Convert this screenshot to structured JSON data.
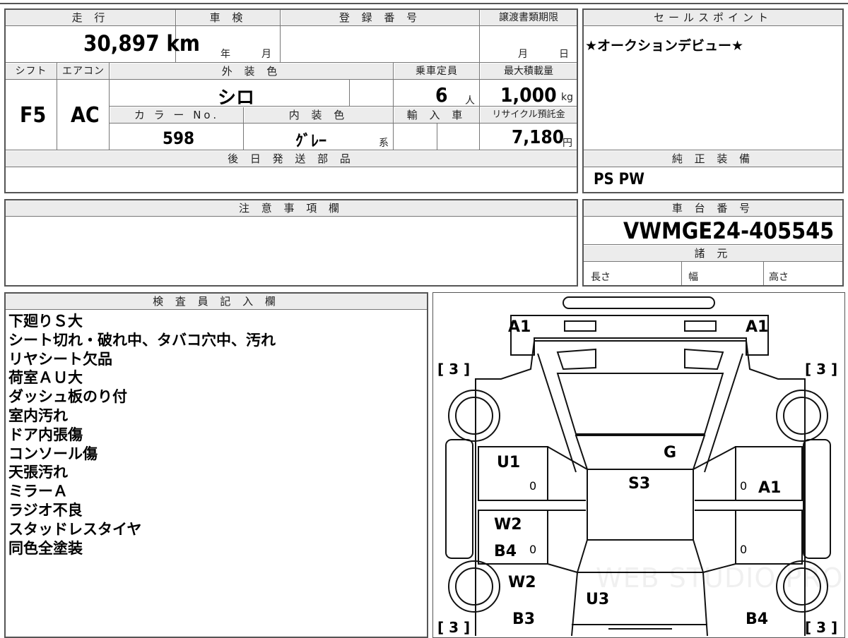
{
  "vehicle": {
    "mileage_label": "走 行",
    "mileage": "30,897 km",
    "shaken_label": "車 検",
    "shaken_year": "年",
    "shaken_month": "月",
    "reg_label": "登 録 番 号",
    "transfer_label": "譲渡書類期限",
    "transfer_month": "月",
    "transfer_day": "日",
    "shift_label": "シフト",
    "shift": "F5",
    "ac_label": "エアコン",
    "ac": "AC",
    "ext_color_label": "外 装 色",
    "ext_color": "シロ",
    "capacity_label": "乗車定員",
    "capacity": "6",
    "capacity_unit": "人",
    "load_label": "最大積載量",
    "load": "1,000",
    "load_unit": "kg",
    "color_no_label": "カ ラ ー No.",
    "color_no": "598",
    "int_color_label": "内 装 色",
    "int_color": "ｸﾞﾚｰ",
    "int_color_suffix": "系",
    "import_label": "輸 入 車",
    "recycle_label": "リサイクル預託金",
    "recycle": "7,180",
    "recycle_unit": "円",
    "later_parts_label": "後 日 発 送 部 品"
  },
  "sales_point": {
    "label": "セールスポイント",
    "text": "★オークションデビュー★"
  },
  "standard_equipment": {
    "label": "純 正 装 備",
    "text": "PS PW"
  },
  "caution": {
    "label": "注 意 事 項 欄"
  },
  "chassis": {
    "label": "車 台 番 号",
    "number": "VWMGE24-405545",
    "specs_label": "諸 元",
    "length_label": "長さ",
    "width_label": "幅",
    "height_label": "高さ"
  },
  "inspector": {
    "label": "検 査 員 記 入 欄",
    "lines": [
      "下廻りＳ大",
      "シート切れ・破れ中、タバコ穴中、汚れ",
      "リヤシート欠品",
      "荷室ＡＵ大",
      "ダッシュ板のり付",
      "室内汚れ",
      "ドア内張傷",
      "コンソール傷",
      "天張汚れ",
      "ミラーＡ",
      "ラジオ不良",
      "スタッドレスタイヤ",
      "同色全塗装"
    ]
  },
  "diagram": {
    "marks": {
      "a1_left": "A1",
      "a1_right": "A1",
      "tire_fl": "[ 3 ]",
      "tire_fr": "[ 3 ]",
      "tire_rl": "[ 3 ]",
      "tire_rr": "[ 3 ]",
      "g": "G",
      "u1": "U1",
      "s3": "S3",
      "a1_door": "A1",
      "w2_upper": "W2",
      "b4_left": "B4",
      "w2_lower": "W2",
      "u3": "U3",
      "b3": "B3",
      "b4_right": "B4",
      "zero_1": "0",
      "zero_2": "0",
      "zero_3": "0",
      "zero_4": "0"
    },
    "watermark": "WEB STUDIO PRO"
  }
}
